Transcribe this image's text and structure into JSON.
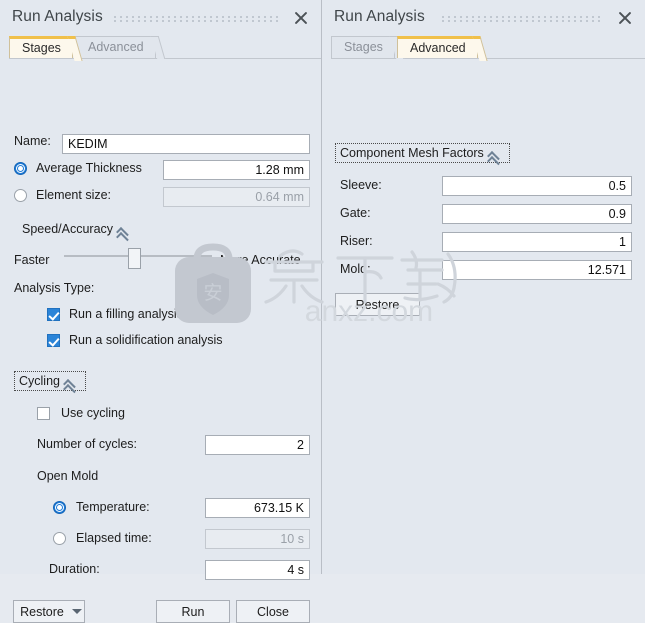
{
  "left_panel": {
    "title": "Run Analysis",
    "close_icon": "close-icon",
    "tabs": [
      {
        "label": "Stages",
        "active": true
      },
      {
        "label": "Advanced",
        "active": false
      }
    ],
    "name_label": "Name:",
    "name_value": "KEDIM",
    "average_thickness": {
      "label": "Average Thickness",
      "value": "1.28 mm",
      "selected": true
    },
    "element_size": {
      "label": "Element size:",
      "value": "0.64 mm",
      "selected": false,
      "disabled": true
    },
    "speed_accuracy": {
      "header": "Speed/Accuracy",
      "collapse_icon": "chevron-up-double-icon",
      "min_label": "Faster",
      "max_label": "More Accurate",
      "value_percent": 48
    },
    "analysis_type": {
      "label": "Analysis Type:",
      "options": [
        {
          "label": "Run a filling analysis",
          "checked": true
        },
        {
          "label": "Run a solidification analysis",
          "checked": true
        }
      ]
    },
    "cycling": {
      "header": "Cycling",
      "collapse_icon": "chevron-up-double-icon",
      "use_cycling_label": "Use cycling",
      "use_cycling_checked": false,
      "number_of_cycles_label": "Number of cycles:",
      "number_of_cycles_value": "2",
      "open_mold_label": "Open Mold",
      "temperature": {
        "label": "Temperature:",
        "value": "673.15 K",
        "selected": true
      },
      "elapsed_time": {
        "label": "Elapsed time:",
        "value": "10 s",
        "selected": false,
        "disabled": true
      },
      "duration": {
        "label": "Duration:",
        "value": "4 s"
      }
    },
    "buttons": {
      "restore": "Restore",
      "restore_caret_icon": "chevron-down-icon",
      "run": "Run",
      "close": "Close"
    }
  },
  "right_panel": {
    "title": "Run Analysis",
    "close_icon": "close-icon",
    "tabs": [
      {
        "label": "Stages",
        "active": false
      },
      {
        "label": "Advanced",
        "active": true
      }
    ],
    "component_mesh_factors": {
      "header": "Component Mesh Factors",
      "collapse_icon": "chevron-up-double-icon",
      "fields": [
        {
          "label": "Sleeve:",
          "value": "0.5"
        },
        {
          "label": "Gate:",
          "value": "0.9"
        },
        {
          "label": "Riser:",
          "value": "1"
        },
        {
          "label": "Mold:",
          "value": "12.571"
        }
      ],
      "restore_label": "Restore"
    }
  },
  "watermark": {
    "badge_glyph": "安",
    "outline_text": "安下载",
    "site": "anxz.com"
  },
  "colors": {
    "accent_blue": "#2b84d8",
    "tab_active_top": "#f0c04a",
    "panel_bg": "#e3e8ef"
  }
}
